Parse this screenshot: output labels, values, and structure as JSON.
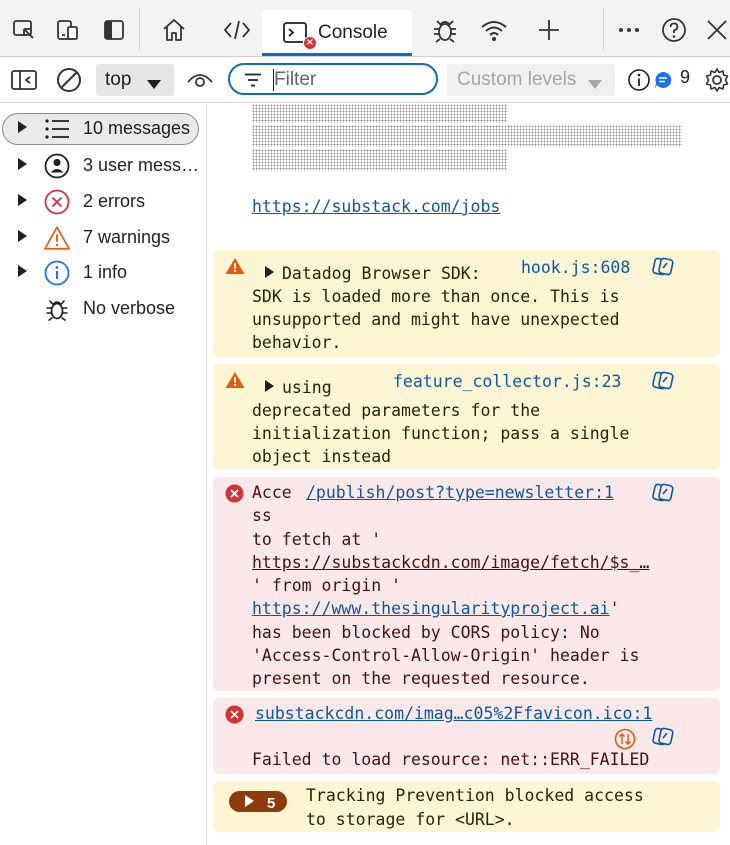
{
  "tabs": {
    "console_label": "Console"
  },
  "toolbar": {
    "context": "top",
    "filter_placeholder": "Filter",
    "levels": "Custom levels",
    "issues_count": "9"
  },
  "sidebar": {
    "items": [
      {
        "label": "10 messages",
        "icon": "list-icon"
      },
      {
        "label": "3 user messages",
        "icon": "user-icon"
      },
      {
        "label": "2 errors",
        "icon": "error-icon"
      },
      {
        "label": "7 warnings",
        "icon": "warning-icon"
      },
      {
        "label": "1 info",
        "icon": "info-icon"
      },
      {
        "label": "No verbose",
        "icon": "bug-icon"
      }
    ]
  },
  "messages": {
    "jobs_link": "https://substack.com/jobs",
    "warn1": {
      "source": "hook.js:608",
      "lines": [
        "Datadog Browser SDK:",
        "SDK is loaded more than once. This is",
        "unsupported and might have unexpected",
        "behavior."
      ]
    },
    "warn2": {
      "source": "feature_collector.js:23",
      "lines": [
        "using",
        "deprecated parameters for the",
        "initialization function; pass a single",
        "object instead"
      ]
    },
    "err1": {
      "source": "/publish/post?type=newsletter:1",
      "line1": "Acce",
      "line2": "ss",
      "line3": "to fetch at '",
      "url1": "https://substackcdn.com/image/fetch/$s_…",
      "line5": "' from origin '",
      "url2": "https://www.thesingularityproject.ai",
      "line6_tail": "'",
      "line7": "has been blocked by CORS policy: No",
      "line8": "'Access-Control-Allow-Origin' header is",
      "line9": "present on the requested resource."
    },
    "err2": {
      "source": "substackcdn.com/imag…c05%2Ffavicon.ico:1",
      "text": "Failed to load resource: net::ERR_FAILED"
    },
    "group": {
      "count": "5",
      "line1": "Tracking Prevention blocked access",
      "line2": "to storage for <URL>."
    }
  },
  "colors": {
    "accent": "#0f6cbd",
    "warning_bg": "#fdf6d5",
    "error_bg": "#fbe9e9",
    "error_icon": "#d13438",
    "warning_icon": "#e8590c",
    "link": "#0b57a6"
  }
}
